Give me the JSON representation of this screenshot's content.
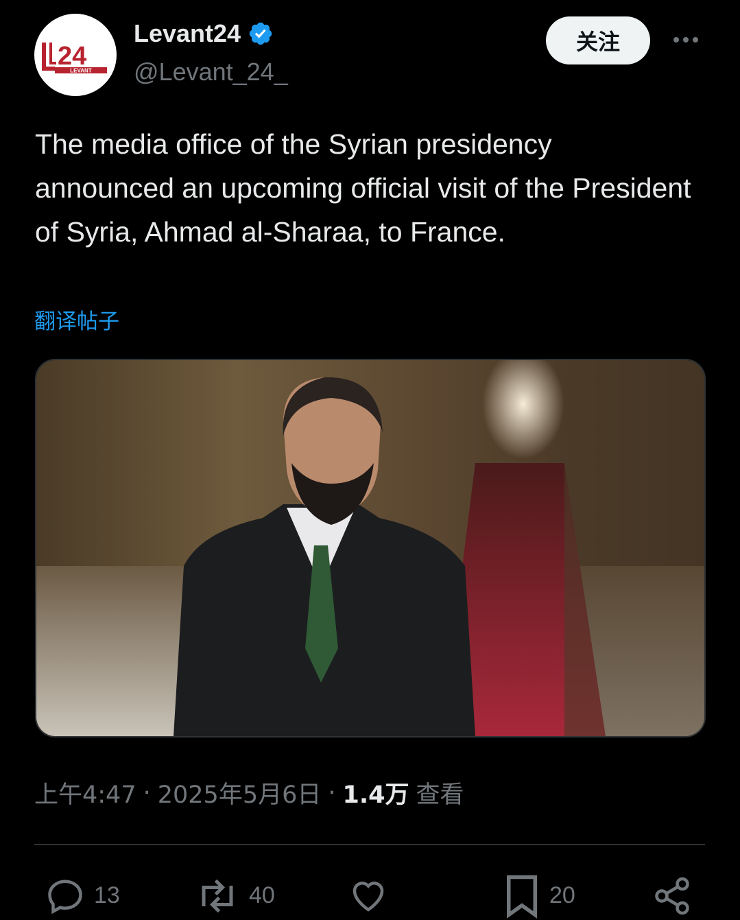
{
  "author": {
    "display_name": "Levant24",
    "handle": "@Levant_24_",
    "avatar_logo_text": "24",
    "avatar_logo_subtext": "LEVANT",
    "verified": true,
    "verified_color": "#1d9bf0"
  },
  "header": {
    "follow_label": "关注",
    "more_icon": "more-horizontal-icon"
  },
  "post": {
    "text": "The media office of the Syrian presidency announced an upcoming official visit of the President of Syria, Ahmad al-Sharaa, to France.",
    "translate_label": "翻译帖子"
  },
  "meta": {
    "time": "上午4:47",
    "sep1": "·",
    "date": "2025年5月6日",
    "sep2": "·",
    "views_count": "1.4万",
    "views_label": "查看"
  },
  "actions": {
    "reply": {
      "icon": "reply-icon",
      "count": "13"
    },
    "repost": {
      "icon": "repost-icon",
      "count": "40"
    },
    "like": {
      "icon": "heart-icon",
      "count": ""
    },
    "bookmark": {
      "icon": "bookmark-icon",
      "count": "20"
    },
    "share": {
      "icon": "share-icon"
    }
  },
  "colors": {
    "background": "#000000",
    "text": "#e7e9ea",
    "secondary": "#71767b",
    "link": "#1d9bf0",
    "logo_red": "#b7232f"
  }
}
